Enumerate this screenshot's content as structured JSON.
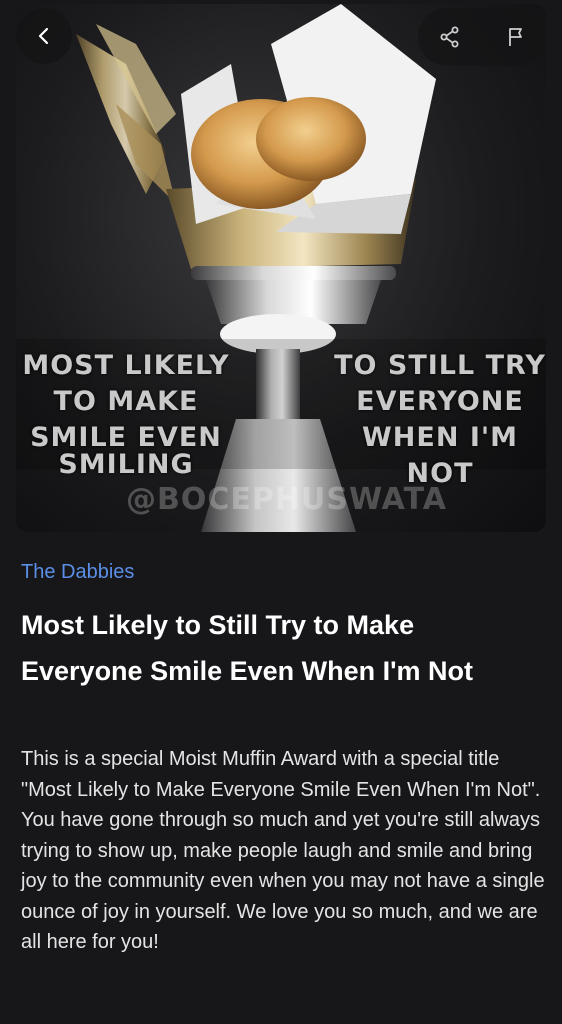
{
  "hero": {
    "caption_left_lines": [
      "MOST LIKELY",
      "TO MAKE",
      "SMILE EVEN",
      "SMILING"
    ],
    "caption_right_lines": [
      "TO STILL TRY",
      "EVERYONE",
      "WHEN I'M NOT"
    ],
    "watermark": "@BOCEPHUSWATA"
  },
  "toolbar": {
    "back_icon": "chevron-left-icon",
    "share_icon": "share-icon",
    "flag_icon": "flag-icon"
  },
  "content": {
    "category": "The Dabbies",
    "title": "Most Likely to Still Try to Make Everyone Smile Even When I'm Not",
    "description": "This is a special Moist Muffin Award with a special title \"Most Likely to Make Everyone Smile Even When I'm Not\". You have gone through so much and yet you're still always trying to show up, make people laugh and smile and bring joy to the community even when you may not have a single ounce of joy in yourself. We love you so much, and we are all here for you!"
  },
  "colors": {
    "background": "#17171a",
    "category_link": "#5b8ee6",
    "text_primary": "#ffffff"
  }
}
